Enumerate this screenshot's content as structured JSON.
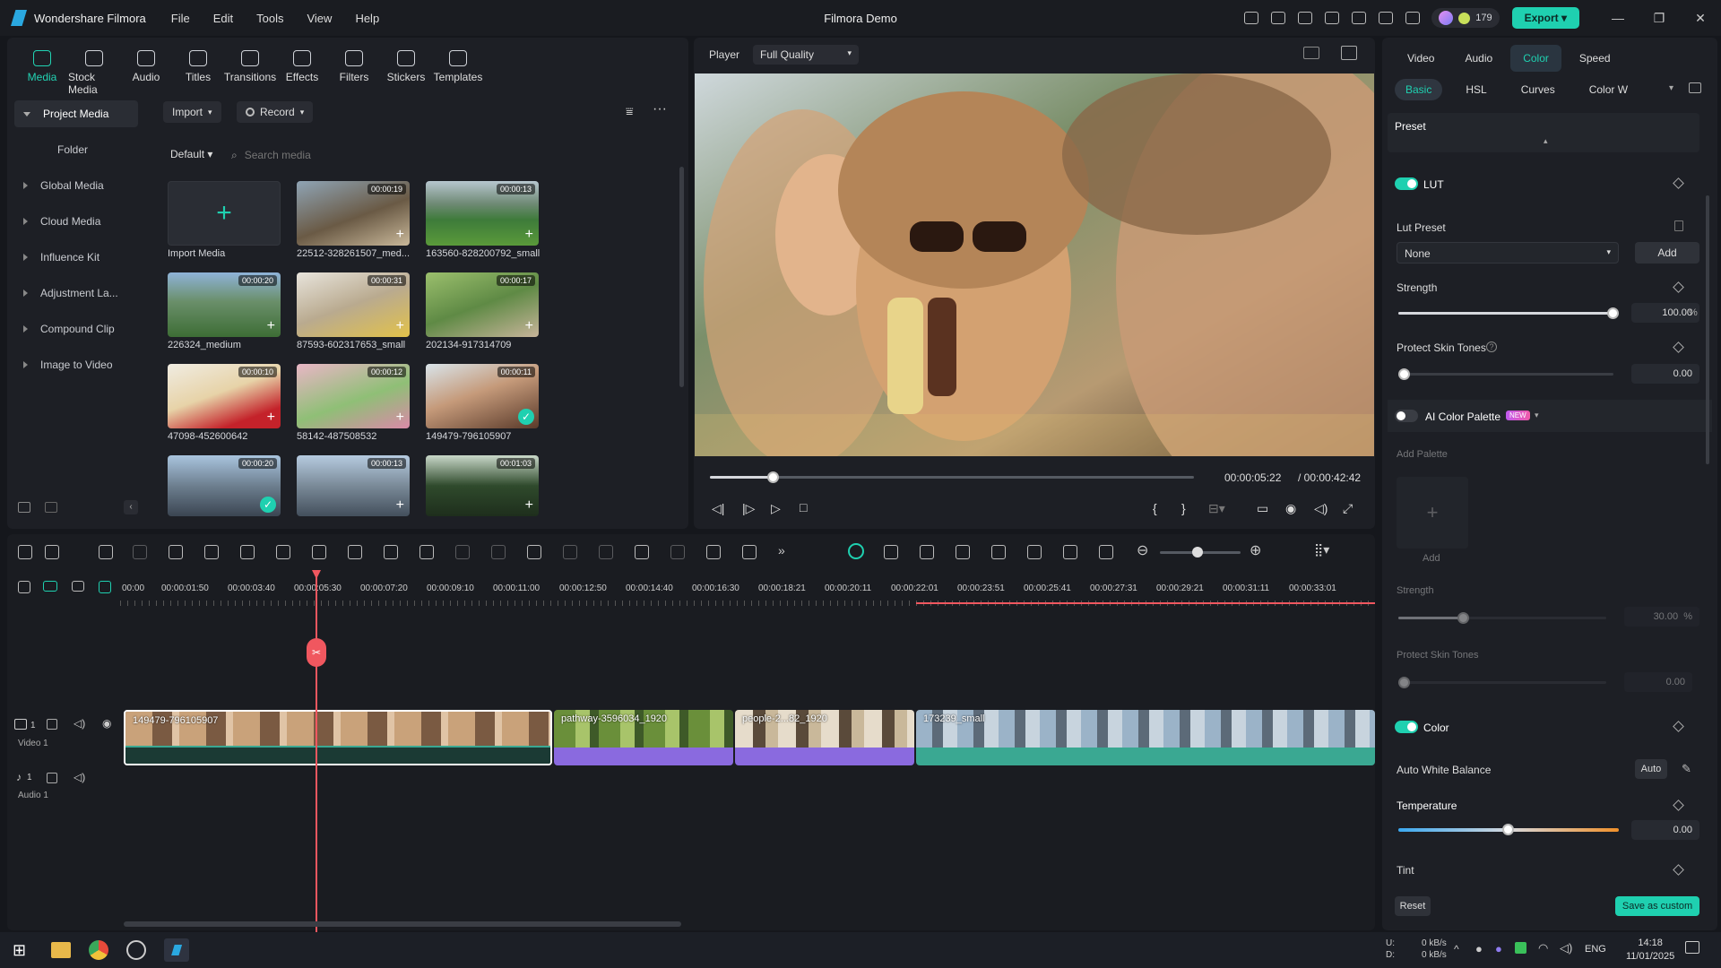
{
  "app": {
    "name": "Wondershare Filmora",
    "window_title": "Filmora Demo",
    "menu": [
      "File",
      "Edit",
      "Tools",
      "View",
      "Help"
    ],
    "credits": "179",
    "export": "Export"
  },
  "media_tabs": [
    "Media",
    "Stock Media",
    "Audio",
    "Titles",
    "Transitions",
    "Effects",
    "Filters",
    "Stickers",
    "Templates"
  ],
  "sidebar": [
    "Project Media",
    "Folder",
    "Global Media",
    "Cloud Media",
    "Influence Kit",
    "Adjustment La...",
    "Compound Clip",
    "Image to Video"
  ],
  "library": {
    "import": "Import",
    "record": "Record",
    "sort": "Default",
    "search_placeholder": "Search media",
    "import_media": "Import Media",
    "items": [
      {
        "name": "22512-328261507_med...",
        "dur": "00:00:19"
      },
      {
        "name": "163560-828200792_small",
        "dur": "00:00:13"
      },
      {
        "name": "226324_medium",
        "dur": "00:00:20"
      },
      {
        "name": "87593-602317653_small",
        "dur": "00:00:31"
      },
      {
        "name": "202134-917314709",
        "dur": "00:00:17"
      },
      {
        "name": "47098-452600642",
        "dur": "00:00:10"
      },
      {
        "name": "58142-487508532",
        "dur": "00:00:12"
      },
      {
        "name": "149479-796105907",
        "dur": "00:00:11"
      },
      {
        "name": "",
        "dur": "00:00:20"
      },
      {
        "name": "",
        "dur": "00:00:13"
      },
      {
        "name": "",
        "dur": "00:01:03"
      }
    ]
  },
  "player": {
    "label": "Player",
    "quality": "Full Quality",
    "current": "00:00:05:22",
    "total": "/ 00:00:42:42",
    "progress": 0.13
  },
  "right_panel": {
    "tabs": [
      "Video",
      "Audio",
      "Color",
      "Speed"
    ],
    "subtabs": [
      "Basic",
      "HSL",
      "Curves",
      "Color W"
    ],
    "preset": "Preset",
    "lut": "LUT",
    "lut_preset": "Lut Preset",
    "lut_value": "None",
    "add": "Add",
    "strength": "Strength",
    "strength_value": "100.00",
    "pct": "%",
    "protect": "Protect Skin Tones",
    "protect_value": "0.00",
    "ai_palette": "AI Color Palette",
    "new_badge": "NEW",
    "add_palette": "Add Palette",
    "add_label": "Add",
    "ai_strength": "Strength",
    "ai_strength_value": "30.00",
    "ai_protect": "Protect Skin Tones",
    "ai_protect_value": "0.00",
    "color": "Color",
    "awb": "Auto White Balance",
    "auto": "Auto",
    "temperature": "Temperature",
    "temperature_value": "0.00",
    "tint": "Tint",
    "reset": "Reset",
    "save_custom": "Save as custom"
  },
  "timeline": {
    "ruler": [
      "00:00",
      "00:00:01:50",
      "00:00:03:40",
      "00:00:05:30",
      "00:00:07:20",
      "00:00:09:10",
      "00:00:11:00",
      "00:00:12:50",
      "00:00:14:40",
      "00:00:16:30",
      "00:00:18:21",
      "00:00:20:11",
      "00:00:22:01",
      "00:00:23:51",
      "00:00:25:41",
      "00:00:27:31",
      "00:00:29:21",
      "00:00:31:11",
      "00:00:33:01"
    ],
    "tracks": {
      "video": "Video 1",
      "audio": "Audio 1",
      "v_num": "1",
      "a_num": "1"
    },
    "clips": [
      {
        "label": "149479-796105907"
      },
      {
        "label": "pathway-3596034_1920"
      },
      {
        "label": "people-2...82_1920"
      },
      {
        "label": "173239_small"
      }
    ]
  },
  "taskbar": {
    "net_up": "0 kB/s",
    "net_down": "0 kB/s",
    "lang": "ENG",
    "time": "14:18",
    "date": "11/01/2025",
    "u": "U:",
    "d": "D:"
  },
  "colors": {
    "accent": "#1fd0b0",
    "playhead": "#f0575f",
    "clip_purple": "#8a6adf",
    "clip_teal": "#3aa892"
  }
}
